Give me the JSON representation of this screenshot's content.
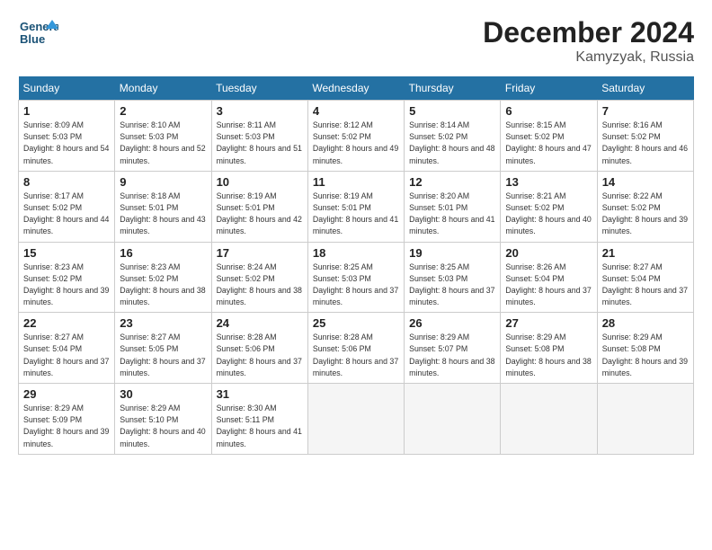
{
  "logo": {
    "line1": "General",
    "line2": "Blue"
  },
  "title": "December 2024",
  "subtitle": "Kamyzyak, Russia",
  "days_of_week": [
    "Sunday",
    "Monday",
    "Tuesday",
    "Wednesday",
    "Thursday",
    "Friday",
    "Saturday"
  ],
  "weeks": [
    [
      {
        "day": 1,
        "sunrise": "8:09 AM",
        "sunset": "5:03 PM",
        "daylight": "8 hours and 54 minutes."
      },
      {
        "day": 2,
        "sunrise": "8:10 AM",
        "sunset": "5:03 PM",
        "daylight": "8 hours and 52 minutes."
      },
      {
        "day": 3,
        "sunrise": "8:11 AM",
        "sunset": "5:03 PM",
        "daylight": "8 hours and 51 minutes."
      },
      {
        "day": 4,
        "sunrise": "8:12 AM",
        "sunset": "5:02 PM",
        "daylight": "8 hours and 49 minutes."
      },
      {
        "day": 5,
        "sunrise": "8:14 AM",
        "sunset": "5:02 PM",
        "daylight": "8 hours and 48 minutes."
      },
      {
        "day": 6,
        "sunrise": "8:15 AM",
        "sunset": "5:02 PM",
        "daylight": "8 hours and 47 minutes."
      },
      {
        "day": 7,
        "sunrise": "8:16 AM",
        "sunset": "5:02 PM",
        "daylight": "8 hours and 46 minutes."
      }
    ],
    [
      {
        "day": 8,
        "sunrise": "8:17 AM",
        "sunset": "5:02 PM",
        "daylight": "8 hours and 44 minutes."
      },
      {
        "day": 9,
        "sunrise": "8:18 AM",
        "sunset": "5:01 PM",
        "daylight": "8 hours and 43 minutes."
      },
      {
        "day": 10,
        "sunrise": "8:19 AM",
        "sunset": "5:01 PM",
        "daylight": "8 hours and 42 minutes."
      },
      {
        "day": 11,
        "sunrise": "8:19 AM",
        "sunset": "5:01 PM",
        "daylight": "8 hours and 41 minutes."
      },
      {
        "day": 12,
        "sunrise": "8:20 AM",
        "sunset": "5:01 PM",
        "daylight": "8 hours and 41 minutes."
      },
      {
        "day": 13,
        "sunrise": "8:21 AM",
        "sunset": "5:02 PM",
        "daylight": "8 hours and 40 minutes."
      },
      {
        "day": 14,
        "sunrise": "8:22 AM",
        "sunset": "5:02 PM",
        "daylight": "8 hours and 39 minutes."
      }
    ],
    [
      {
        "day": 15,
        "sunrise": "8:23 AM",
        "sunset": "5:02 PM",
        "daylight": "8 hours and 39 minutes."
      },
      {
        "day": 16,
        "sunrise": "8:23 AM",
        "sunset": "5:02 PM",
        "daylight": "8 hours and 38 minutes."
      },
      {
        "day": 17,
        "sunrise": "8:24 AM",
        "sunset": "5:02 PM",
        "daylight": "8 hours and 38 minutes."
      },
      {
        "day": 18,
        "sunrise": "8:25 AM",
        "sunset": "5:03 PM",
        "daylight": "8 hours and 37 minutes."
      },
      {
        "day": 19,
        "sunrise": "8:25 AM",
        "sunset": "5:03 PM",
        "daylight": "8 hours and 37 minutes."
      },
      {
        "day": 20,
        "sunrise": "8:26 AM",
        "sunset": "5:04 PM",
        "daylight": "8 hours and 37 minutes."
      },
      {
        "day": 21,
        "sunrise": "8:27 AM",
        "sunset": "5:04 PM",
        "daylight": "8 hours and 37 minutes."
      }
    ],
    [
      {
        "day": 22,
        "sunrise": "8:27 AM",
        "sunset": "5:04 PM",
        "daylight": "8 hours and 37 minutes."
      },
      {
        "day": 23,
        "sunrise": "8:27 AM",
        "sunset": "5:05 PM",
        "daylight": "8 hours and 37 minutes."
      },
      {
        "day": 24,
        "sunrise": "8:28 AM",
        "sunset": "5:06 PM",
        "daylight": "8 hours and 37 minutes."
      },
      {
        "day": 25,
        "sunrise": "8:28 AM",
        "sunset": "5:06 PM",
        "daylight": "8 hours and 37 minutes."
      },
      {
        "day": 26,
        "sunrise": "8:29 AM",
        "sunset": "5:07 PM",
        "daylight": "8 hours and 38 minutes."
      },
      {
        "day": 27,
        "sunrise": "8:29 AM",
        "sunset": "5:08 PM",
        "daylight": "8 hours and 38 minutes."
      },
      {
        "day": 28,
        "sunrise": "8:29 AM",
        "sunset": "5:08 PM",
        "daylight": "8 hours and 39 minutes."
      }
    ],
    [
      {
        "day": 29,
        "sunrise": "8:29 AM",
        "sunset": "5:09 PM",
        "daylight": "8 hours and 39 minutes."
      },
      {
        "day": 30,
        "sunrise": "8:29 AM",
        "sunset": "5:10 PM",
        "daylight": "8 hours and 40 minutes."
      },
      {
        "day": 31,
        "sunrise": "8:30 AM",
        "sunset": "5:11 PM",
        "daylight": "8 hours and 41 minutes."
      },
      null,
      null,
      null,
      null
    ]
  ]
}
